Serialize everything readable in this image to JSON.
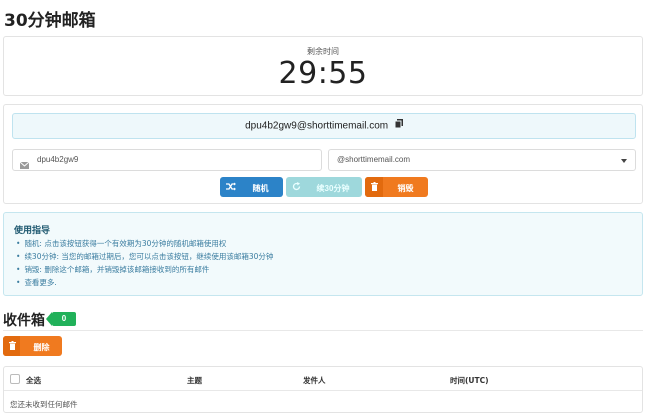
{
  "title": "30分钟邮箱",
  "timer": {
    "label": "剩余时间",
    "value": "29:55"
  },
  "email": {
    "address": "dpu4b2gw9@shorttimemail.com",
    "username": "dpu4b2gw9",
    "domain": "@shorttimemail.com",
    "copy_icon": "copy-icon",
    "input_icon": "envelope-icon"
  },
  "buttons": {
    "random": {
      "label": "随机",
      "icon": "shuffle-icon",
      "color": "#2c83c8"
    },
    "extend": {
      "label": "续30分钟",
      "icon": "refresh-icon",
      "color": "#9ed8dc"
    },
    "destroy": {
      "label": "销毁",
      "icon": "trash-icon",
      "color": "#f07a1f"
    }
  },
  "guide": {
    "title": "使用指导",
    "items": [
      "随机: 点击该按钮获得一个有效期为30分钟的随机邮箱使用权",
      "续30分钟: 当您的邮箱过期后，您可以点击该按钮，继续使用该邮箱30分钟",
      "销毁: 删除这个邮箱，并销毁掉该邮箱接收到的所有邮件",
      "查看更多."
    ]
  },
  "inbox": {
    "title": "收件箱",
    "count": "0",
    "badge_color": "#21b15a",
    "delete_label": "删除",
    "columns": [
      "全选",
      "主题",
      "发件人",
      "时间(UTC)"
    ],
    "empty_text": "您还未收到任何邮件"
  }
}
